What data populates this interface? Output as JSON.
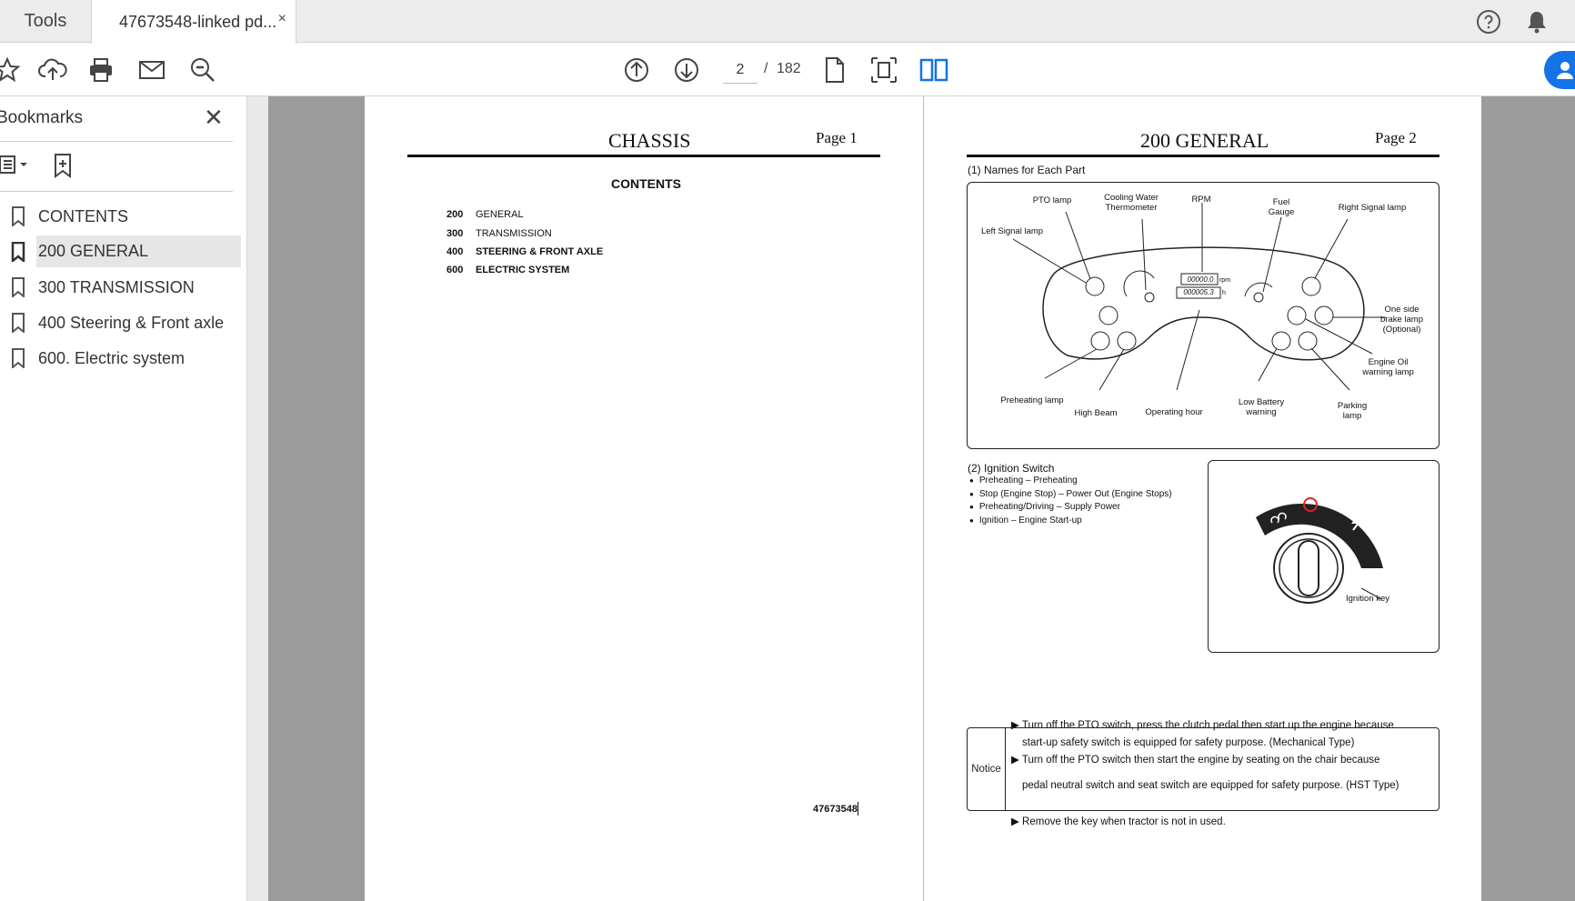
{
  "tabs": {
    "tools_label": "Tools",
    "doc_label": "47673548-linked pd...",
    "close_glyph": "×"
  },
  "toolbar": {
    "current_page": "2",
    "page_sep": "/",
    "total_pages": "182"
  },
  "sidebar": {
    "title": "Bookmarks",
    "items": [
      {
        "label": "CONTENTS",
        "selected": false
      },
      {
        "label": "200 GENERAL",
        "selected": true
      },
      {
        "label": "300 TRANSMISSION",
        "selected": false
      },
      {
        "label": "400 Steering & Front axle",
        "selected": false
      },
      {
        "label": "600. Electric system",
        "selected": false
      }
    ]
  },
  "page1": {
    "title": "CHASSIS",
    "page_label": "Page 1",
    "contents_title": "CONTENTS",
    "toc": [
      {
        "num": "200",
        "name": "GENERAL"
      },
      {
        "num": "300",
        "name": "TRANSMISSION"
      },
      {
        "num": "400",
        "name": "STEERING & FRONT AXLE"
      },
      {
        "num": "600",
        "name": "ELECTRIC SYSTEM"
      }
    ],
    "doc_number": "47673548"
  },
  "page2": {
    "title": "200  GENERAL",
    "page_label": "Page 2",
    "section1": "(1) Names for Each Part",
    "dash_labels": {
      "pto_lamp": "PTO lamp",
      "cooling": "Cooling Water\nThermometer",
      "rpm": "RPM",
      "fuel": "Fuel\nGauge",
      "right_signal": "Right Signal lamp",
      "left_signal": "Left Signal lamp",
      "one_side": "One side\nbrake lamp\n(Optional)",
      "engine_oil": "Engine Oil\nwarning lamp",
      "preheating": "Preheating lamp",
      "high_beam": "High Beam",
      "operating": "Operating hour",
      "low_battery": "Low Battery\nwarning",
      "parking": "Parking\nlamp"
    },
    "readout_top": "00000.0",
    "readout_top_unit": "rpm",
    "readout_bottom": "000005.3",
    "readout_bottom_unit": "h",
    "section2": "(2) Ignition Switch",
    "ignition_items": [
      "Preheating – Preheating",
      "Stop (Engine Stop) – Power Out (Engine Stops)",
      "Preheating/Driving – Supply Power",
      "Ignition – Engine Start-up"
    ],
    "ignition_key_label": "Ignition key",
    "notice_label": "Notice",
    "notes": [
      "Turn off the PTO switch, press the clutch pedal then start up the engine because",
      "start-up safety switch is equipped for safety purpose. (Mechanical Type)",
      "Turn off the PTO switch then start the engine by seating on the chair because",
      "pedal neutral switch and seat switch are equipped for safety purpose. (HST Type)",
      "Remove the key when tractor is not in used."
    ]
  }
}
